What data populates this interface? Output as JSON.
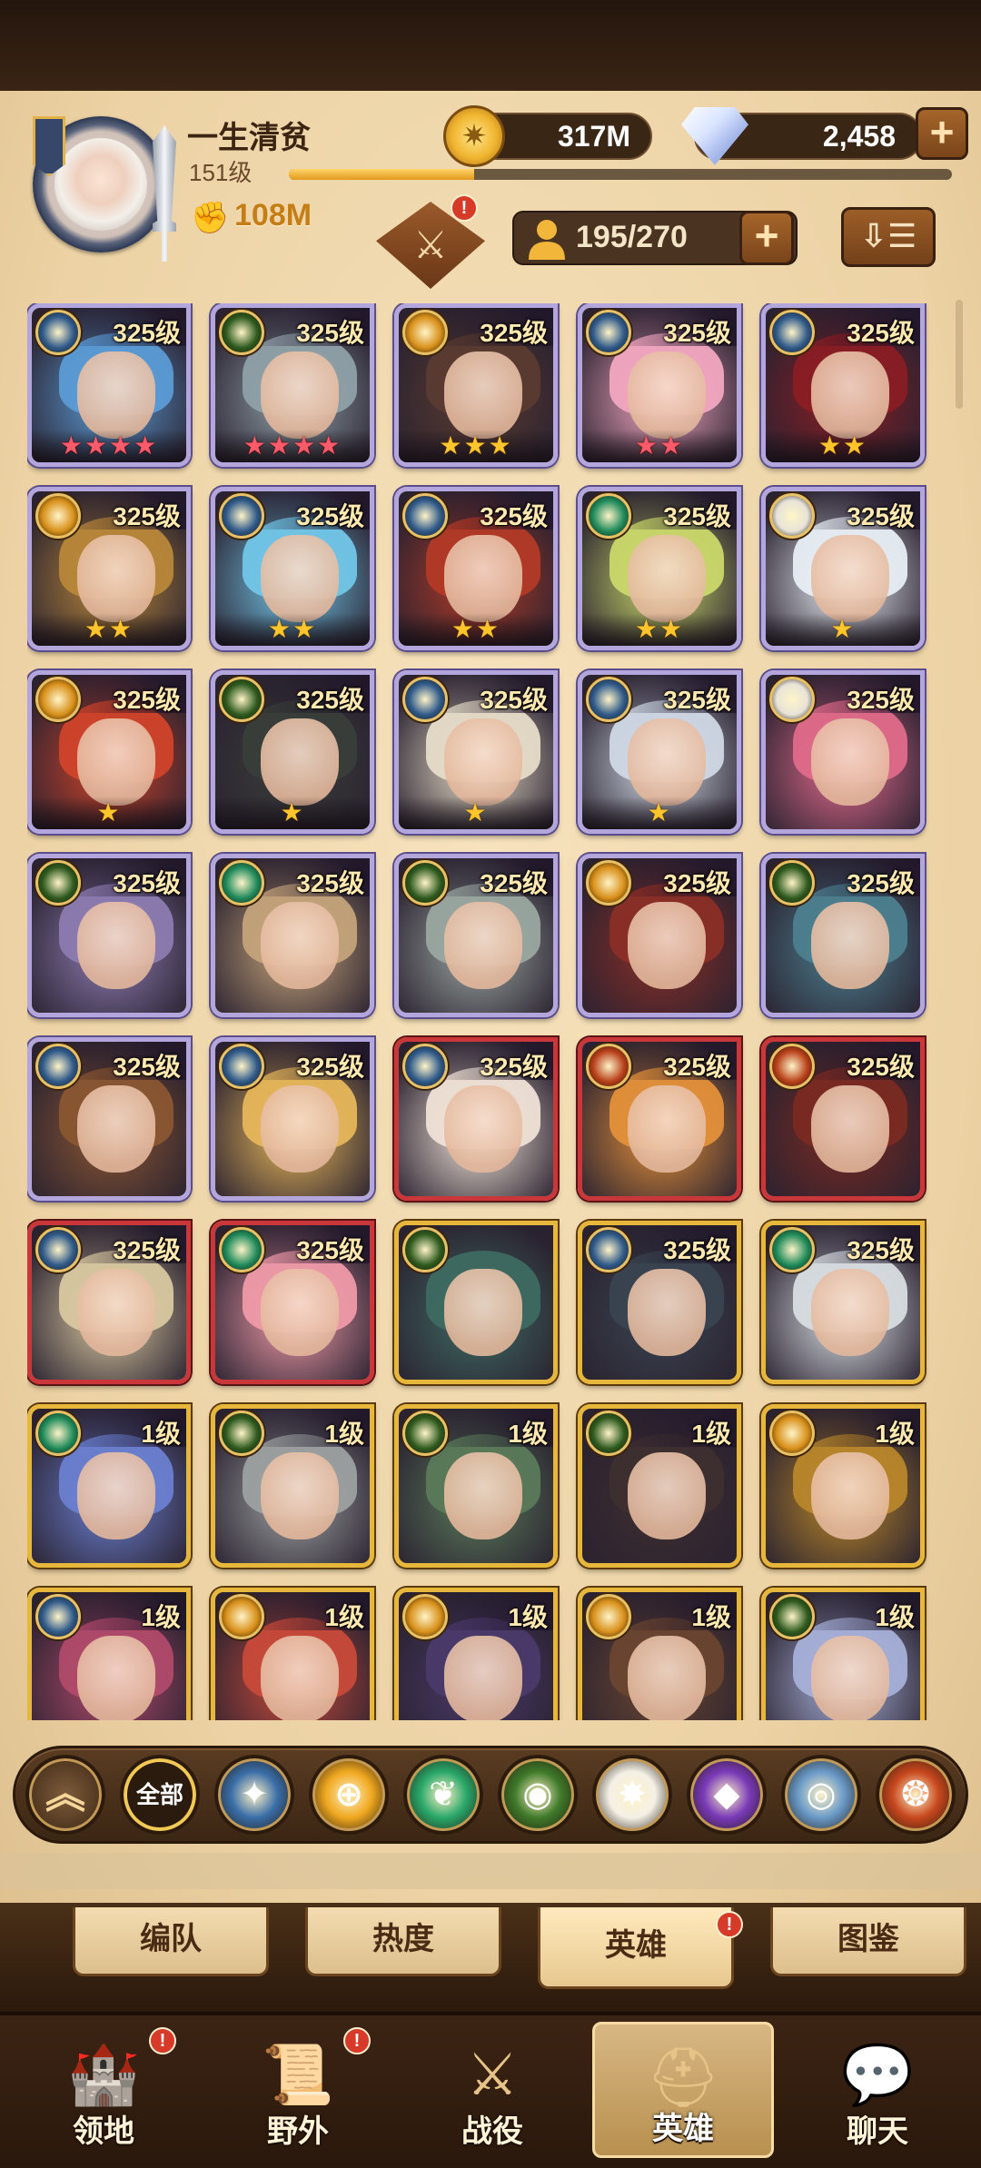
{
  "header": {
    "player_name": "一生清贫",
    "player_level": "151级",
    "xp_fraction": 0.28,
    "power": "108M",
    "gold": "317M",
    "gems": "2,458",
    "plus_symbol": "+",
    "emblem_alert": "!",
    "roster_count": "195/270",
    "sort_icon": "sort-icon"
  },
  "heroes": [
    {
      "level": "325级",
      "faction": "celestial",
      "stars": "★★★★",
      "star_color": "red",
      "frame": "purple",
      "art": "#5b9bd5"
    },
    {
      "level": "325级",
      "faction": "graveborn",
      "stars": "★★★★",
      "star_color": "red",
      "frame": "purple",
      "art": "#8fa0a8"
    },
    {
      "level": "325级",
      "faction": "lightbearer",
      "stars": "★★★",
      "star_color": "gold",
      "frame": "purple",
      "art": "#5a3b30"
    },
    {
      "level": "325级",
      "faction": "celestial",
      "stars": "★★",
      "star_color": "red",
      "frame": "purple",
      "art": "#f2a7c0"
    },
    {
      "level": "325级",
      "faction": "celestial",
      "stars": "★★",
      "star_color": "gold",
      "frame": "purple",
      "art": "#8a1e24"
    },
    {
      "level": "325级",
      "faction": "lightbearer",
      "stars": "★★",
      "star_color": "gold",
      "frame": "purple",
      "art": "#b8873a"
    },
    {
      "level": "325级",
      "faction": "celestial",
      "stars": "★★",
      "star_color": "gold",
      "frame": "purple",
      "art": "#72c6e8"
    },
    {
      "level": "325级",
      "faction": "celestial",
      "stars": "★★",
      "star_color": "gold",
      "frame": "purple",
      "art": "#b23a26"
    },
    {
      "level": "325级",
      "faction": "wilder",
      "stars": "★★",
      "star_color": "gold",
      "frame": "purple",
      "art": "#c9d86a"
    },
    {
      "level": "325级",
      "faction": "dimensional",
      "stars": "★",
      "star_color": "gold",
      "frame": "purple",
      "art": "#e8eef4"
    },
    {
      "level": "325级",
      "faction": "lightbearer",
      "stars": "★",
      "star_color": "gold",
      "frame": "purple",
      "art": "#d0432a"
    },
    {
      "level": "325级",
      "faction": "graveborn",
      "stars": "★",
      "star_color": "gold",
      "frame": "purple",
      "art": "#3a3e3a"
    },
    {
      "level": "325级",
      "faction": "celestial",
      "stars": "★",
      "star_color": "gold",
      "frame": "purple",
      "art": "#e6dcc8"
    },
    {
      "level": "325级",
      "faction": "celestial",
      "stars": "★",
      "star_color": "gold",
      "frame": "purple",
      "art": "#cfd8e4"
    },
    {
      "level": "325级",
      "faction": "dimensional",
      "stars": "",
      "star_color": "gold",
      "frame": "purple",
      "art": "#e06a8a"
    },
    {
      "level": "325级",
      "faction": "graveborn",
      "stars": "",
      "star_color": "gold",
      "frame": "purple",
      "art": "#8c7bb0"
    },
    {
      "level": "325级",
      "faction": "wilder",
      "stars": "",
      "star_color": "gold",
      "frame": "purple",
      "art": "#c4a37a"
    },
    {
      "level": "325级",
      "faction": "graveborn",
      "stars": "",
      "star_color": "gold",
      "frame": "purple",
      "art": "#9aa6a0"
    },
    {
      "level": "325级",
      "faction": "lightbearer",
      "stars": "",
      "star_color": "gold",
      "frame": "purple",
      "art": "#8a2e26"
    },
    {
      "level": "325级",
      "faction": "graveborn",
      "stars": "",
      "star_color": "gold",
      "frame": "purple",
      "art": "#4c7f8f"
    },
    {
      "level": "325级",
      "faction": "celestial",
      "stars": "",
      "star_color": "gold",
      "frame": "purple",
      "art": "#8a5632"
    },
    {
      "level": "325级",
      "faction": "celestial",
      "stars": "",
      "star_color": "gold",
      "frame": "purple",
      "art": "#e6b65a"
    },
    {
      "level": "325级",
      "faction": "celestial",
      "stars": "",
      "star_color": "gold",
      "frame": "red",
      "art": "#efe2d6"
    },
    {
      "level": "325级",
      "faction": "hypogean",
      "stars": "",
      "star_color": "gold",
      "frame": "red",
      "art": "#e3903a"
    },
    {
      "level": "325级",
      "faction": "hypogean",
      "stars": "",
      "star_color": "gold",
      "frame": "red",
      "art": "#7a2a22"
    },
    {
      "level": "325级",
      "faction": "celestial",
      "stars": "",
      "star_color": "gold",
      "frame": "red",
      "art": "#d8c8a0"
    },
    {
      "level": "325级",
      "faction": "wilder",
      "stars": "",
      "star_color": "gold",
      "frame": "red",
      "art": "#ef9aa8"
    },
    {
      "level": "",
      "faction": "graveborn",
      "stars": "",
      "star_color": "gold",
      "frame": "gold",
      "art": "#3e6a62"
    },
    {
      "level": "325级",
      "faction": "celestial",
      "stars": "",
      "star_color": "gold",
      "frame": "gold",
      "art": "#3a4450"
    },
    {
      "level": "325级",
      "faction": "wilder",
      "stars": "",
      "star_color": "gold",
      "frame": "gold",
      "art": "#d8dde2"
    },
    {
      "level": "1级",
      "faction": "wilder",
      "stars": "",
      "star_color": "gold",
      "frame": "gold",
      "art": "#6a7fd0"
    },
    {
      "level": "1级",
      "faction": "graveborn",
      "stars": "",
      "star_color": "gold",
      "frame": "gold",
      "art": "#9ca0a0"
    },
    {
      "level": "1级",
      "faction": "graveborn",
      "stars": "",
      "star_color": "gold",
      "frame": "gold",
      "art": "#5a7a5a"
    },
    {
      "level": "1级",
      "faction": "graveborn",
      "stars": "",
      "star_color": "gold",
      "frame": "gold",
      "art": "#3e2e30"
    },
    {
      "level": "1级",
      "faction": "lightbearer",
      "stars": "",
      "star_color": "gold",
      "frame": "gold",
      "art": "#b8862a"
    },
    {
      "level": "1级",
      "faction": "celestial",
      "stars": "",
      "star_color": "gold",
      "frame": "gold",
      "art": "#b04a6a"
    },
    {
      "level": "1级",
      "faction": "lightbearer",
      "stars": "",
      "star_color": "gold",
      "frame": "gold",
      "art": "#c74a3a"
    },
    {
      "level": "1级",
      "faction": "lightbearer",
      "stars": "",
      "star_color": "gold",
      "frame": "gold",
      "art": "#4a3a6a"
    },
    {
      "level": "1级",
      "faction": "lightbearer",
      "stars": "",
      "star_color": "gold",
      "frame": "gold",
      "art": "#6a4630"
    },
    {
      "level": "1级",
      "faction": "graveborn",
      "stars": "",
      "star_color": "gold",
      "frame": "gold",
      "art": "#a6b0d8"
    }
  ],
  "faction_colors": {
    "celestial": "#2f5a8a",
    "lightbearer": "#d8901a",
    "graveborn": "#2e5a1e",
    "wilder": "#1f8a5a",
    "dimensional": "#e7e3d8",
    "hypogean": "#b8401a"
  },
  "filters": [
    {
      "name": "collapse",
      "label": "︽",
      "icon": "chevron-up-icon",
      "color": "#5a3a1e"
    },
    {
      "name": "all",
      "label": "全部",
      "icon": "",
      "color": "#2a1b0e"
    },
    {
      "name": "celestial",
      "label": "✦",
      "icon": "celestial-faction-icon",
      "color": "#3a6ea8"
    },
    {
      "name": "lightbearer",
      "label": "⊕",
      "icon": "lightbearer-faction-icon",
      "color": "#f0a820"
    },
    {
      "name": "wilder",
      "label": "❦",
      "icon": "wilder-faction-icon",
      "color": "#2aa86a"
    },
    {
      "name": "graveborn",
      "label": "◉",
      "icon": "graveborn-faction-icon",
      "color": "#3f7a2a"
    },
    {
      "name": "dimensional",
      "label": "✸",
      "icon": "dimensional-faction-icon",
      "color": "#f4f0e6"
    },
    {
      "name": "mauler",
      "label": "◆",
      "icon": "mauler-faction-icon",
      "color": "#7a3ab8"
    },
    {
      "name": "tidal",
      "label": "◎",
      "icon": "tidal-faction-icon",
      "color": "#6a9ac8"
    },
    {
      "name": "hypogean",
      "label": "❂",
      "icon": "hypogean-faction-icon",
      "color": "#c8481e"
    }
  ],
  "subtabs": [
    {
      "label": "编队",
      "active": false,
      "alert": ""
    },
    {
      "label": "热度",
      "active": false,
      "alert": ""
    },
    {
      "label": "英雄",
      "active": true,
      "alert": "!"
    },
    {
      "label": "图鉴",
      "active": false,
      "alert": ""
    }
  ],
  "bottom_nav": [
    {
      "label": "领地",
      "icon": "castle-icon",
      "glyph": "🏰",
      "alert": "!",
      "active": false
    },
    {
      "label": "野外",
      "icon": "map-scroll-icon",
      "glyph": "📜",
      "alert": "!",
      "active": false
    },
    {
      "label": "战役",
      "icon": "sword-wings-icon",
      "glyph": "⚔",
      "alert": "",
      "active": false
    },
    {
      "label": "英雄",
      "icon": "helmet-icon",
      "glyph": "⛑",
      "alert": "",
      "active": true
    },
    {
      "label": "聊天",
      "icon": "chat-bubble-icon",
      "glyph": "💬",
      "alert": "",
      "active": false
    }
  ]
}
